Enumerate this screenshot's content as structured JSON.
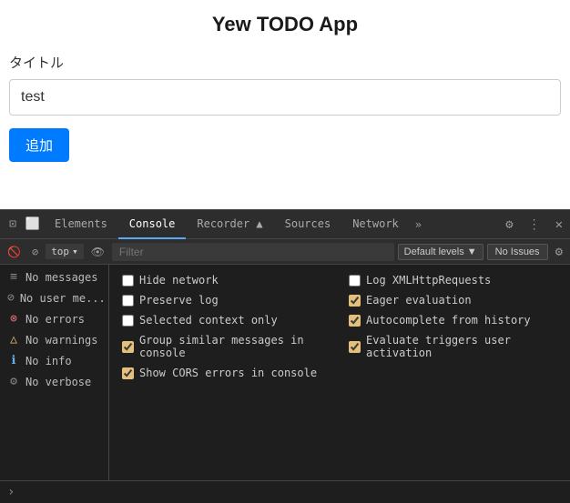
{
  "app": {
    "title": "Yew TODO App",
    "field_label": "タイトル",
    "input_value": "test",
    "add_button_label": "追加"
  },
  "devtools": {
    "tabs": [
      {
        "label": "Elements",
        "active": false
      },
      {
        "label": "Console",
        "active": true
      },
      {
        "label": "Recorder ▲",
        "active": false
      },
      {
        "label": "Sources",
        "active": false
      },
      {
        "label": "Network",
        "active": false
      },
      {
        "label": "»",
        "active": false
      }
    ],
    "console_toolbar": {
      "level": "top",
      "filter_placeholder": "Filter",
      "default_levels": "Default levels ▼",
      "no_issues": "No Issues"
    },
    "sidebar_items": [
      {
        "icon": "≡",
        "icon_class": "icon-list",
        "label": "No messages"
      },
      {
        "icon": "⊘",
        "icon_class": "icon-user",
        "label": "No user me..."
      },
      {
        "icon": "⊗",
        "icon_class": "icon-error",
        "label": "No errors"
      },
      {
        "icon": "△",
        "icon_class": "icon-warn",
        "label": "No warnings"
      },
      {
        "icon": "ℹ",
        "icon_class": "icon-info",
        "label": "No info"
      },
      {
        "icon": "⚙",
        "icon_class": "icon-verbose",
        "label": "No verbose"
      }
    ],
    "settings": [
      {
        "label": "Hide network",
        "checked": false,
        "yellow": false
      },
      {
        "label": "Log XMLHttpRequests",
        "checked": false,
        "yellow": false
      },
      {
        "label": "Preserve log",
        "checked": false,
        "yellow": false
      },
      {
        "label": "Eager evaluation",
        "checked": true,
        "yellow": true
      },
      {
        "label": "Selected context only",
        "checked": false,
        "yellow": false
      },
      {
        "label": "Autocomplete from history",
        "checked": true,
        "yellow": true
      },
      {
        "label": "Group similar messages in console",
        "checked": true,
        "yellow": true
      },
      {
        "label": "Evaluate triggers user activation",
        "checked": true,
        "yellow": true
      },
      {
        "label": "Show CORS errors in console",
        "checked": true,
        "yellow": true
      }
    ],
    "prompt_arrow": ">"
  }
}
